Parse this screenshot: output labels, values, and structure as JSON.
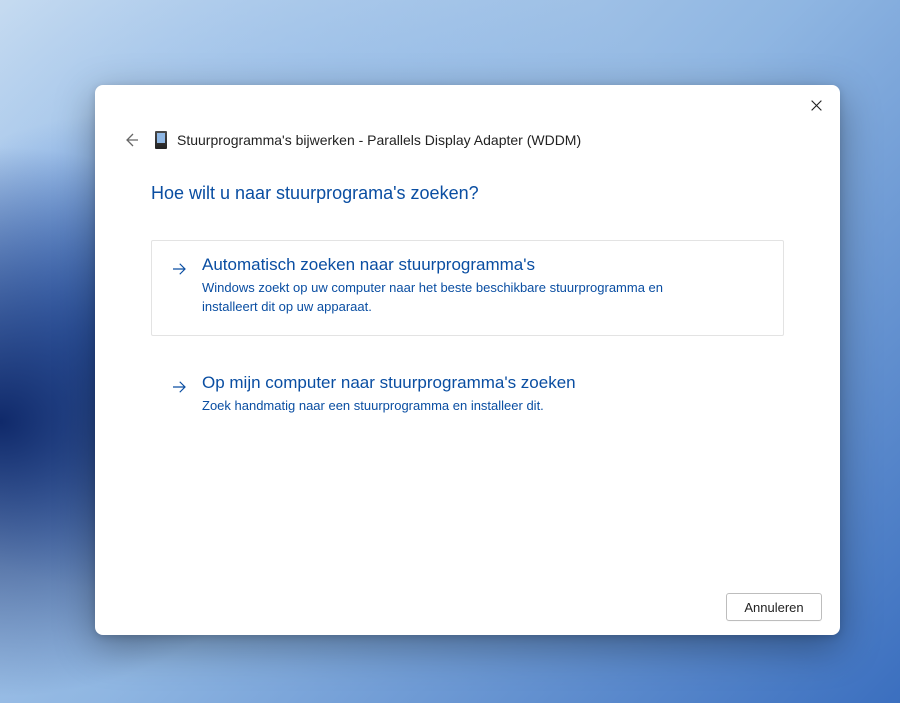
{
  "window": {
    "title": "Stuurprogramma's bijwerken - Parallels Display Adapter (WDDM)"
  },
  "question": "Hoe wilt u naar stuurprograma's zoeken?",
  "options": [
    {
      "title": "Automatisch zoeken naar stuurprogramma's",
      "description": "Windows zoekt op uw computer naar het beste beschikbare stuurprogramma en installeert dit op uw apparaat."
    },
    {
      "title": "Op mijn computer naar stuurprogramma's zoeken",
      "description": "Zoek handmatig naar een stuurprogramma en installeer dit."
    }
  ],
  "buttons": {
    "cancel": "Annuleren"
  }
}
